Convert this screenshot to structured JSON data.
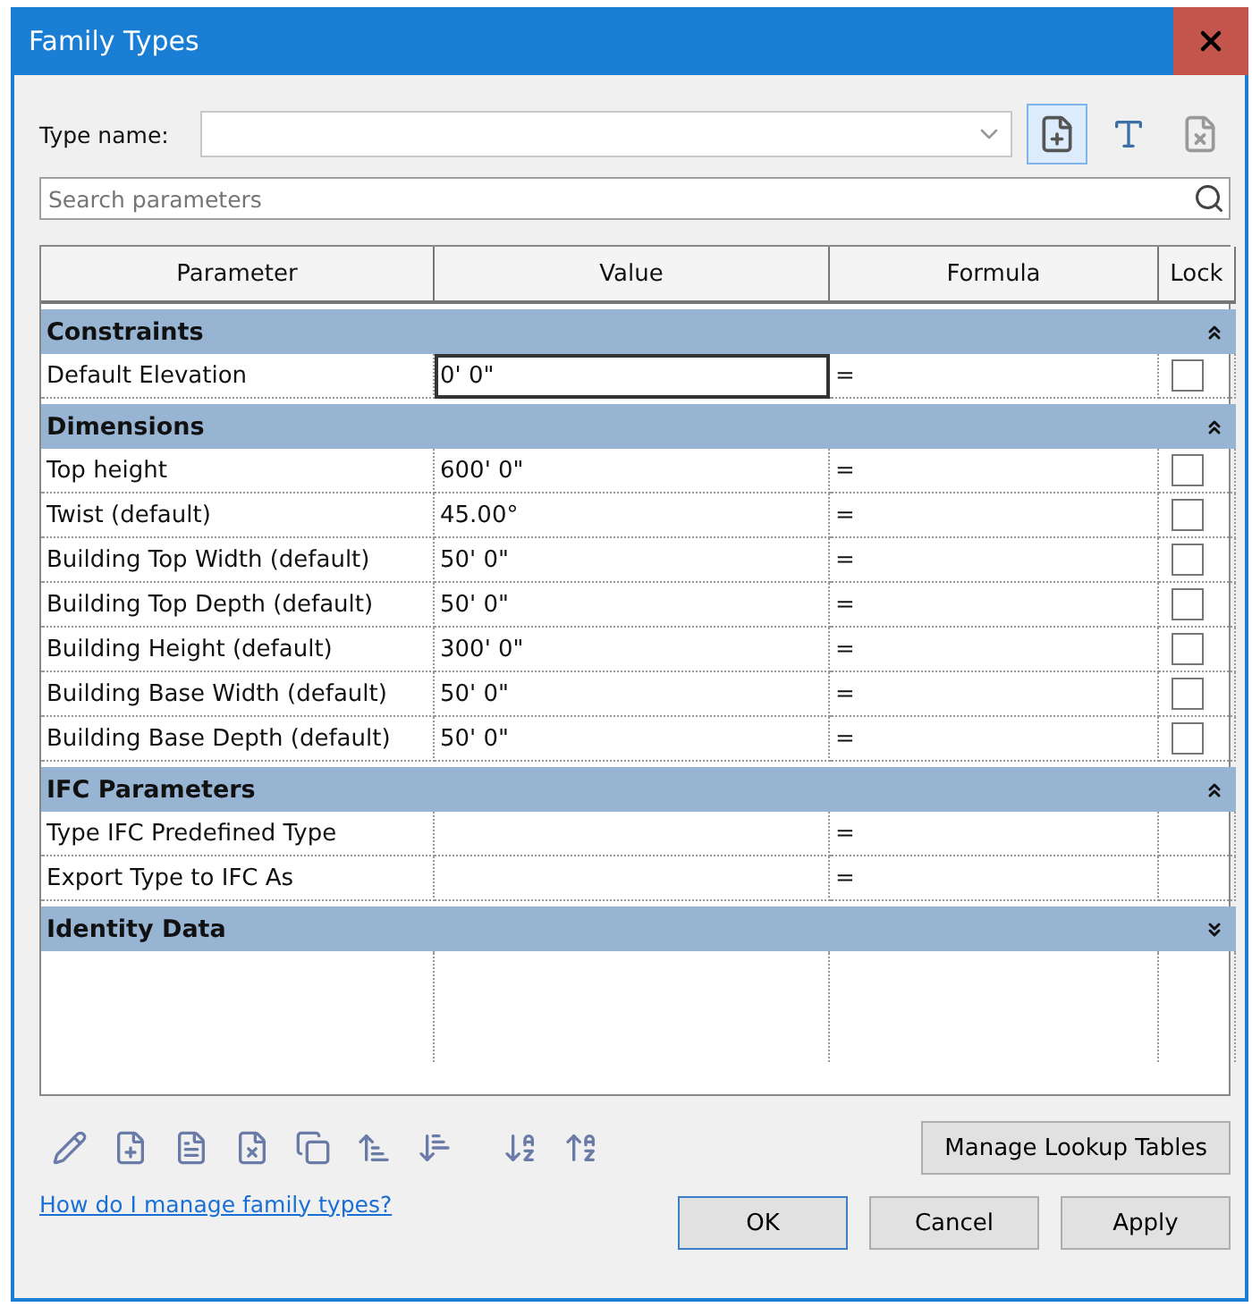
{
  "window": {
    "title": "Family Types"
  },
  "type_name": {
    "label": "Type name:"
  },
  "search": {
    "placeholder": "Search parameters"
  },
  "table": {
    "columns": [
      "Parameter",
      "Value",
      "Formula",
      "Lock"
    ],
    "groups": [
      {
        "name": "Constraints",
        "expanded": true,
        "rows": [
          {
            "parameter": "Default Elevation",
            "value": "0'  0\"",
            "formula": "=",
            "locked": false,
            "focused": true
          }
        ]
      },
      {
        "name": "Dimensions",
        "expanded": true,
        "rows": [
          {
            "parameter": "Top height",
            "value": "600'  0\"",
            "formula": "=",
            "locked": false,
            "focused": false
          },
          {
            "parameter": "Twist (default)",
            "value": "45.00°",
            "formula": "=",
            "locked": false,
            "focused": false
          },
          {
            "parameter": "Building Top Width (default)",
            "value": "50'  0\"",
            "formula": "=",
            "locked": false,
            "focused": false
          },
          {
            "parameter": "Building Top Depth (default)",
            "value": "50'  0\"",
            "formula": "=",
            "locked": false,
            "focused": false
          },
          {
            "parameter": "Building Height (default)",
            "value": "300'  0\"",
            "formula": "=",
            "locked": false,
            "focused": false
          },
          {
            "parameter": "Building Base Width (default)",
            "value": "50'  0\"",
            "formula": "=",
            "locked": false,
            "focused": false
          },
          {
            "parameter": "Building Base Depth (default)",
            "value": "50'  0\"",
            "formula": "=",
            "locked": false,
            "focused": false
          }
        ]
      },
      {
        "name": "IFC Parameters",
        "expanded": true,
        "rows": [
          {
            "parameter": "Type IFC Predefined Type",
            "formula": "=",
            "focused": false
          },
          {
            "parameter": "Export Type to IFC As",
            "formula": "=",
            "focused": false
          }
        ]
      },
      {
        "name": "Identity Data",
        "expanded": false
      }
    ]
  },
  "manage_button": "Manage Lookup Tables",
  "help_link": "How do I manage family types?",
  "buttons": [
    {
      "label": "OK",
      "selected": true
    },
    {
      "label": "Cancel",
      "selected": false
    },
    {
      "label": "Apply",
      "selected": false
    }
  ]
}
